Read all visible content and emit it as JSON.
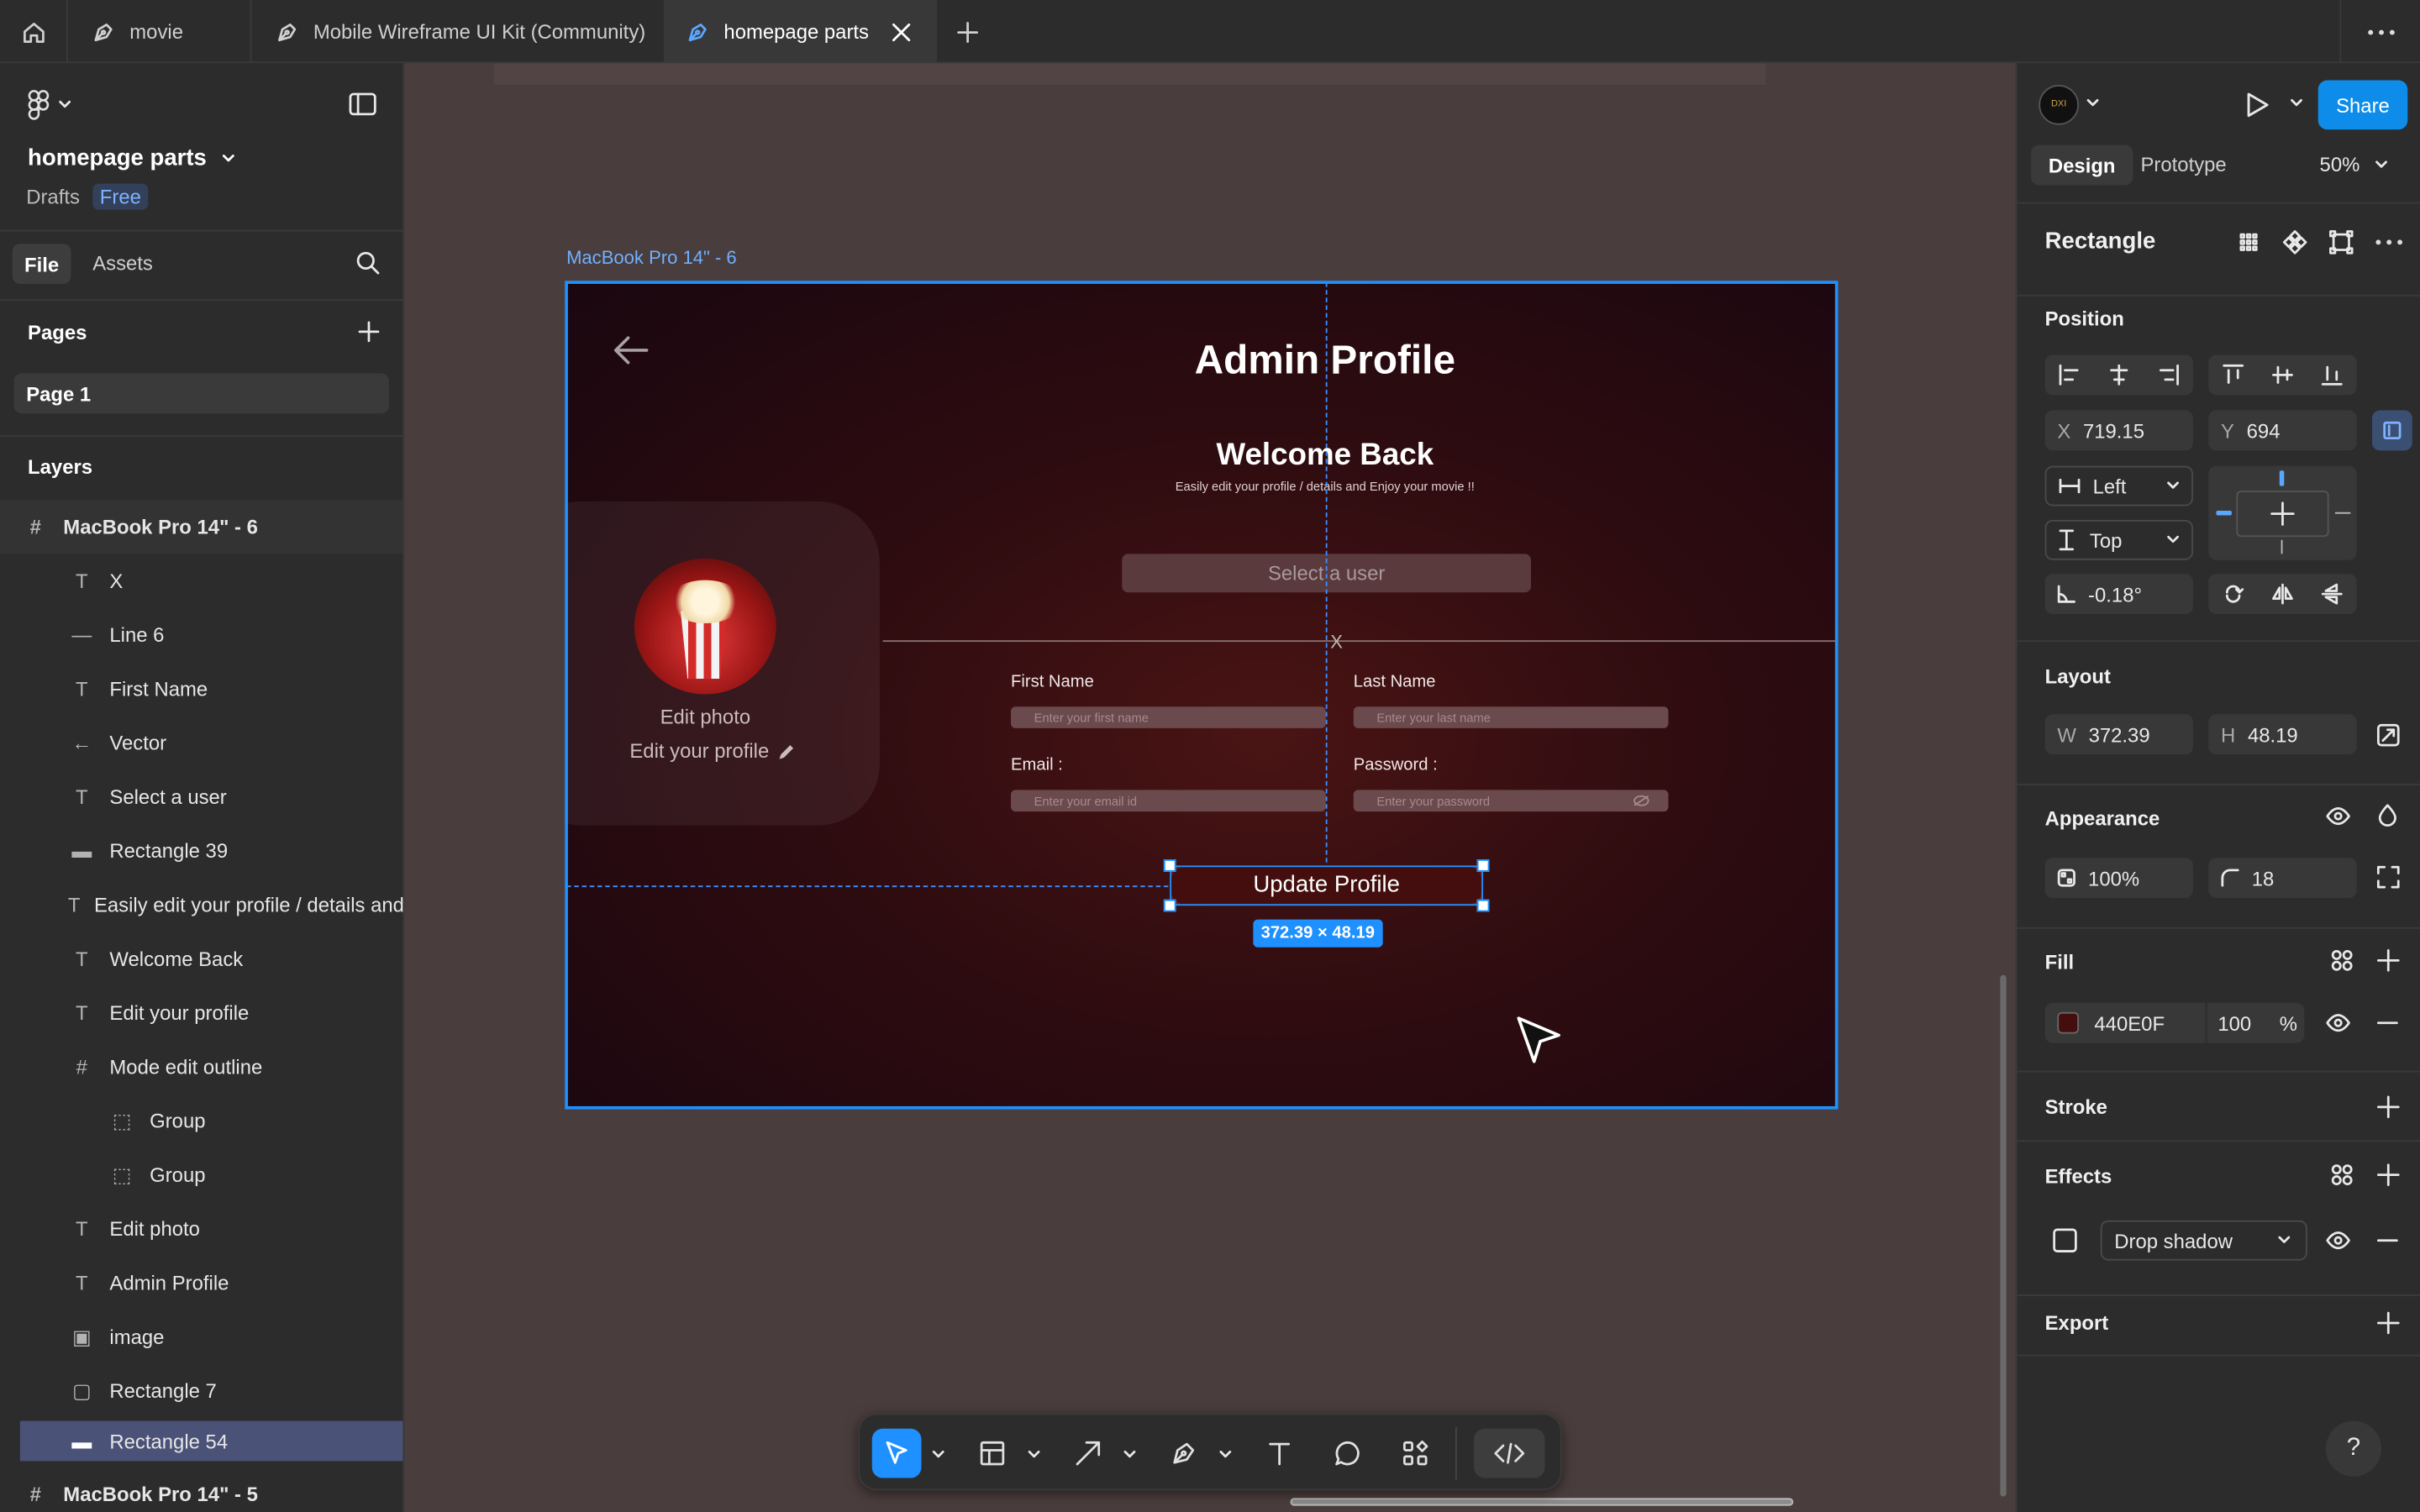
{
  "tabs": [
    {
      "label": "movie"
    },
    {
      "label": "Mobile Wireframe UI Kit (Community)"
    },
    {
      "label": "homepage parts"
    }
  ],
  "left": {
    "file_name": "homepage parts",
    "drafts": "Drafts",
    "plan_badge": "Free",
    "tab_file": "File",
    "tab_assets": "Assets",
    "pages_heading": "Pages",
    "page1": "Page 1",
    "layers_heading": "Layers",
    "layers": [
      "MacBook Pro 14\" - 6",
      "X",
      "Line 6",
      "First Name",
      "Vector",
      "Select a user",
      "Rectangle 39",
      "Easily edit your profile / details and Enjoy your movie !!",
      "Welcome Back",
      "Edit your profile",
      "Mode edit outline",
      "Group",
      "Group",
      "Edit photo",
      "Admin Profile",
      "image",
      "Rectangle 7",
      "Rectangle 54",
      "MacBook Pro 14\" - 5"
    ]
  },
  "canvas": {
    "frame_label": "MacBook Pro 14\" - 6",
    "title": "Admin Profile",
    "welcome": "Welcome Back",
    "subtitle": "Easily edit your profile / details and Enjoy your movie !!",
    "select_user": "Select a user",
    "close_x": "X",
    "edit_photo": "Edit photo",
    "edit_profile": "Edit your profile",
    "first_name_label": "First Name",
    "first_name_ph": "Enter your first name",
    "last_name_label": "Last Name",
    "last_name_ph": "Enter your last name",
    "email_label": "Email :",
    "email_ph": "Enter your email id",
    "password_label": "Password :",
    "password_ph": "Enter your password",
    "update_btn": "Update Profile",
    "size_badge": "372.39 × 48.19"
  },
  "right": {
    "share": "Share",
    "tab_design": "Design",
    "tab_prototype": "Prototype",
    "zoom": "50%",
    "node_title": "Rectangle",
    "position_heading": "Position",
    "x_label": "X",
    "x_value": "719.15",
    "y_label": "Y",
    "y_value": "694",
    "h_constraint": "Left",
    "v_constraint": "Top",
    "rotation": "-0.18°",
    "layout_heading": "Layout",
    "w_label": "W",
    "w_value": "372.39",
    "h_label": "H",
    "h_value": "48.19",
    "appearance_heading": "Appearance",
    "opacity": "100%",
    "radius": "18",
    "fill_heading": "Fill",
    "fill_hex": "440E0F",
    "fill_color": "#440E0F",
    "fill_opacity": "100",
    "fill_pct": "%",
    "stroke_heading": "Stroke",
    "effects_heading": "Effects",
    "effect_type": "Drop shadow",
    "export_heading": "Export",
    "help": "?"
  }
}
